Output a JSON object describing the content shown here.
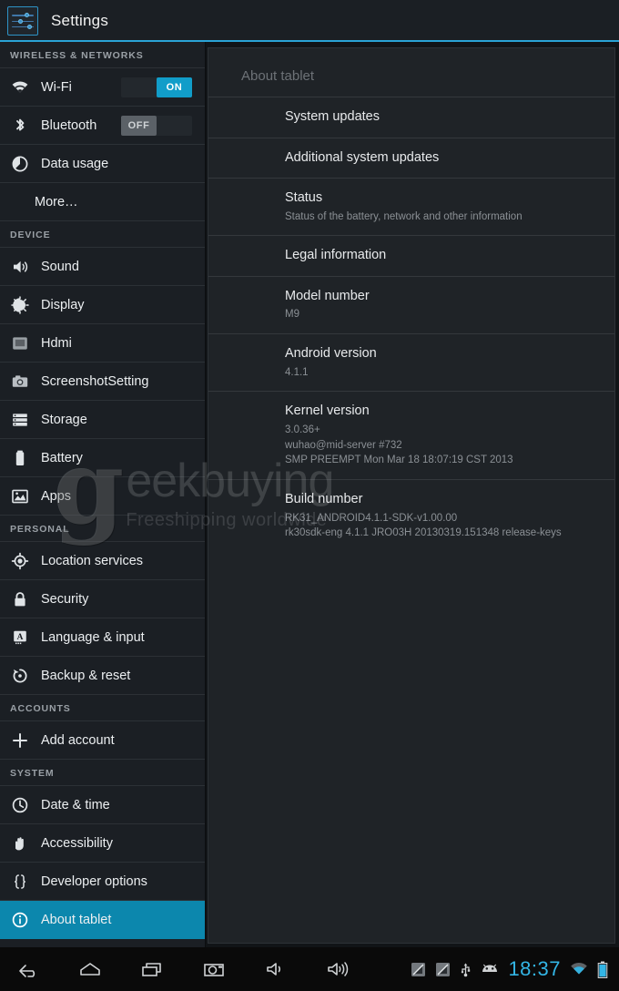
{
  "action_bar": {
    "title": "Settings",
    "icon": "settings-sliders-icon"
  },
  "sidebar": {
    "groups": [
      {
        "header": "WIRELESS & NETWORKS",
        "items": [
          {
            "label": "Wi-Fi",
            "icon": "wifi-icon",
            "toggle": "ON",
            "toggle_state": "on",
            "selected": false
          },
          {
            "label": "Bluetooth",
            "icon": "bluetooth-icon",
            "toggle": "OFF",
            "toggle_state": "off",
            "selected": false
          },
          {
            "label": "Data usage",
            "icon": "data-usage-icon",
            "selected": false
          },
          {
            "label": "More…",
            "icon": null,
            "selected": false
          }
        ]
      },
      {
        "header": "DEVICE",
        "items": [
          {
            "label": "Sound",
            "icon": "sound-icon",
            "selected": false
          },
          {
            "label": "Display",
            "icon": "display-brightness-icon",
            "selected": false
          },
          {
            "label": "Hdmi",
            "icon": "hdmi-monitor-icon",
            "selected": false
          },
          {
            "label": "ScreenshotSetting",
            "icon": "camera-icon",
            "selected": false
          },
          {
            "label": "Storage",
            "icon": "storage-icon",
            "selected": false
          },
          {
            "label": "Battery",
            "icon": "battery-icon",
            "selected": false
          },
          {
            "label": "Apps",
            "icon": "apps-image-icon",
            "selected": false
          }
        ]
      },
      {
        "header": "PERSONAL",
        "items": [
          {
            "label": "Location services",
            "icon": "location-crosshair-icon",
            "selected": false
          },
          {
            "label": "Security",
            "icon": "lock-icon",
            "selected": false
          },
          {
            "label": "Language & input",
            "icon": "language-a-icon",
            "selected": false
          },
          {
            "label": "Backup & reset",
            "icon": "backup-restore-icon",
            "selected": false
          }
        ]
      },
      {
        "header": "ACCOUNTS",
        "items": [
          {
            "label": "Add account",
            "icon": "plus-icon",
            "selected": false
          }
        ]
      },
      {
        "header": "SYSTEM",
        "items": [
          {
            "label": "Date & time",
            "icon": "clock-icon",
            "selected": false
          },
          {
            "label": "Accessibility",
            "icon": "hand-icon",
            "selected": false
          },
          {
            "label": "Developer options",
            "icon": "braces-icon",
            "selected": false
          },
          {
            "label": "About tablet",
            "icon": "info-circle-icon",
            "selected": true
          }
        ]
      }
    ]
  },
  "content": {
    "title": "About tablet",
    "rows": [
      {
        "title": "System updates",
        "sub": []
      },
      {
        "title": "Additional system updates",
        "sub": []
      },
      {
        "title": "Status",
        "sub": [
          "Status of the battery, network and other information"
        ]
      },
      {
        "title": "Legal information",
        "sub": []
      },
      {
        "title": "Model number",
        "sub": [
          "M9"
        ]
      },
      {
        "title": "Android version",
        "sub": [
          "4.1.1"
        ]
      },
      {
        "title": "Kernel version",
        "sub": [
          "3.0.36+",
          "wuhao@mid-server #732",
          "SMP PREEMPT Mon Mar 18 18:07:19 CST 2013"
        ]
      },
      {
        "title": "Build number",
        "sub": [
          "RK31_ANDROID4.1.1-SDK-v1.00.00",
          "rk30sdk-eng 4.1.1 JRO03H 20130319.151348 release-keys"
        ]
      }
    ]
  },
  "watermark": {
    "logo_letter": "g",
    "main": "eekbuying",
    "sub": "Freeshipping worldwide"
  },
  "system_bar": {
    "nav": [
      {
        "name": "back-icon"
      },
      {
        "name": "home-icon"
      },
      {
        "name": "recent-apps-icon"
      },
      {
        "name": "screenshot-camera-icon"
      },
      {
        "name": "volume-down-icon"
      },
      {
        "name": "volume-up-icon"
      }
    ],
    "status": [
      {
        "name": "signal-no-service-icon"
      },
      {
        "name": "signal-no-service-2-icon"
      },
      {
        "name": "usb-icon"
      },
      {
        "name": "android-robot-icon"
      }
    ],
    "clock": "18:37",
    "trailing": [
      {
        "name": "wifi-status-icon"
      },
      {
        "name": "battery-status-icon"
      }
    ]
  },
  "colors": {
    "accent_blue": "#33b5e5",
    "selected_row": "#0c87ad",
    "toggle_on": "#119dc9",
    "panel_bg": "#1f2327",
    "sidebar_bg": "#1b1f24"
  }
}
